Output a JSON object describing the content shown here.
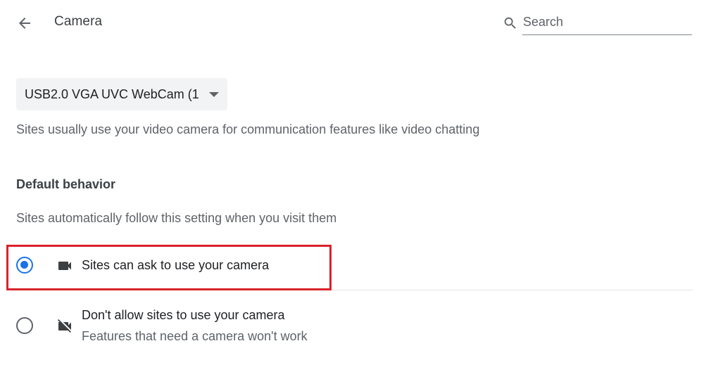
{
  "header": {
    "title": "Camera",
    "back_icon": "arrow-left-icon"
  },
  "search": {
    "placeholder": "Search",
    "value": "",
    "icon": "search-icon"
  },
  "device_select": {
    "selected": "USB2.0 VGA UVC WebCam (1"
  },
  "description": "Sites usually use your video camera for communication features like video chatting",
  "default_behavior": {
    "heading": "Default behavior",
    "subheading": "Sites automatically follow this setting when you visit them",
    "options": [
      {
        "label": "Sites can ask to use your camera",
        "sublabel": "",
        "icon": "videocam-icon",
        "selected": true
      },
      {
        "label": "Don't allow sites to use your camera",
        "sublabel": "Features that need a camera won't work",
        "icon": "videocam-off-icon",
        "selected": false
      }
    ]
  },
  "colors": {
    "accent": "#1a73e8",
    "highlight": "#d9222a"
  }
}
